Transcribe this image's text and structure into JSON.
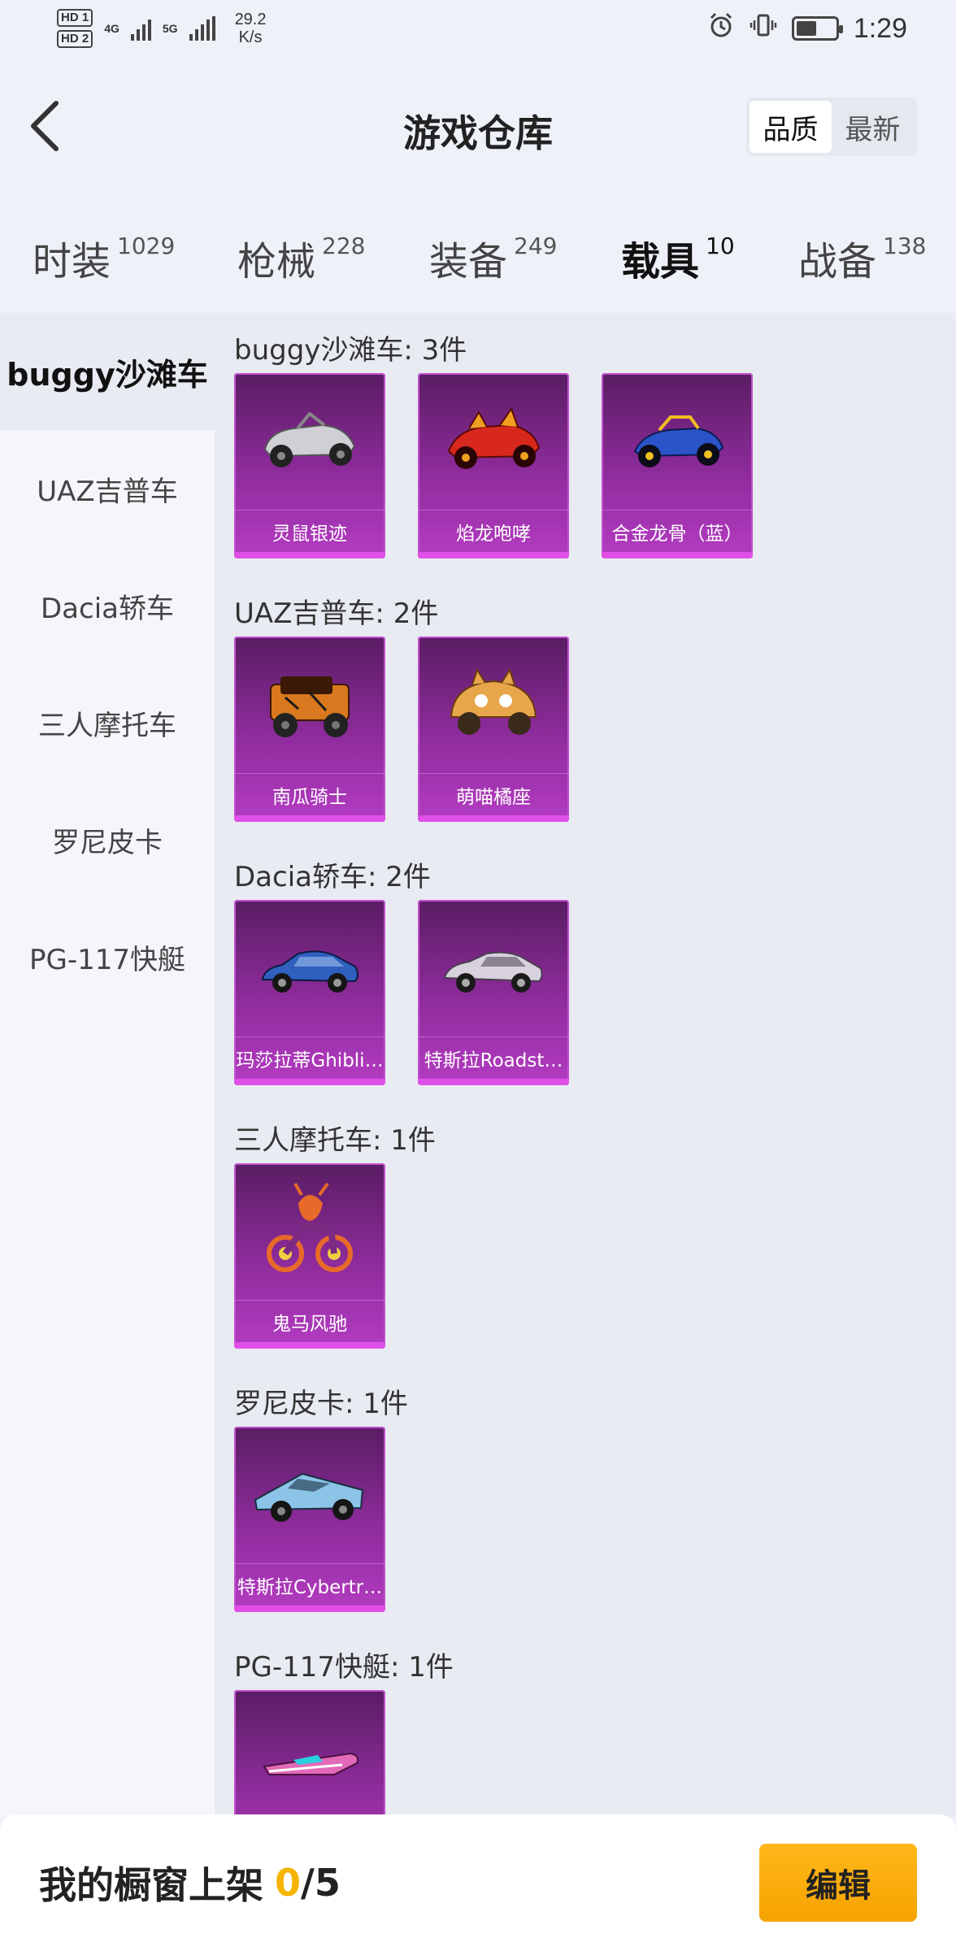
{
  "status_bar": {
    "sim1": "HD 1",
    "sim2": "HD 2",
    "network1": "4G",
    "network2": "5G",
    "speed_value": "29.2",
    "speed_unit": "K/s",
    "time": "1:29"
  },
  "header": {
    "title": "游戏仓库",
    "sort_options": [
      "品质",
      "最新"
    ],
    "sort_selected": "品质"
  },
  "tabs": [
    {
      "label": "时装",
      "count": "1029"
    },
    {
      "label": "枪械",
      "count": "228"
    },
    {
      "label": "装备",
      "count": "249"
    },
    {
      "label": "载具",
      "count": "10",
      "active": true
    },
    {
      "label": "战备",
      "count": "138"
    }
  ],
  "sidebar": {
    "items": [
      "buggy沙滩车",
      "UAZ吉普车",
      "Dacia轿车",
      "三人摩托车",
      "罗尼皮卡",
      "PG-117快艇"
    ],
    "active": "buggy沙滩车"
  },
  "sections": [
    {
      "title": "buggy沙滩车: 3件",
      "items": [
        {
          "name": "灵鼠银迹",
          "icon": "silver-buggy-icon",
          "color": "#c9c9cf"
        },
        {
          "name": "焰龙咆哮",
          "icon": "red-dragon-buggy-icon",
          "color": "#d8281e"
        },
        {
          "name": "合金龙骨（蓝）",
          "icon": "blue-alloy-buggy-icon",
          "color": "#2a54c8"
        }
      ]
    },
    {
      "title": "UAZ吉普车: 2件",
      "items": [
        {
          "name": "南瓜骑士",
          "icon": "pumpkin-jeep-icon",
          "color": "#d9781e"
        },
        {
          "name": "萌喵橘座",
          "icon": "cat-jeep-icon",
          "color": "#e7a64a"
        }
      ]
    },
    {
      "title": "Dacia轿车: 2件",
      "items": [
        {
          "name": "玛莎拉蒂Ghibli…",
          "icon": "blue-sedan-icon",
          "color": "#2f5fbf"
        },
        {
          "name": "特斯拉Roadst…",
          "icon": "white-roadster-icon",
          "color": "#d8d2de"
        }
      ]
    },
    {
      "title": "三人摩托车: 1件",
      "items": [
        {
          "name": "鬼马风驰",
          "icon": "ghost-motorcycle-icon",
          "color": "#e86a2a"
        }
      ]
    },
    {
      "title": "罗尼皮卡: 1件",
      "items": [
        {
          "name": "特斯拉Cybertr…",
          "icon": "cybertruck-icon",
          "color": "#8cc4e8"
        }
      ]
    },
    {
      "title": "PG-117快艇: 1件",
      "items": [
        {
          "name": "",
          "icon": "speedboat-icon",
          "color": "#e26ab8"
        }
      ]
    }
  ],
  "bottom_bar": {
    "label": "我的橱窗上架",
    "current": "0",
    "separator": "/",
    "total": "5",
    "edit_label": "编辑"
  },
  "colors": {
    "accent": "#f5b400",
    "card_purple": "#8f2c9d"
  }
}
